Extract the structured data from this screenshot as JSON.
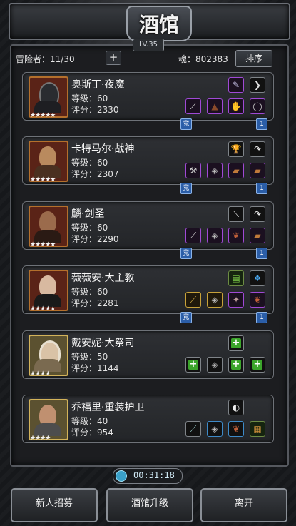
{
  "title": "酒馆",
  "level": "LV.35",
  "topbar": {
    "adventurers": "冒险者：11/30",
    "add_glyph": "+",
    "soul": "魂：802383",
    "sort_label": "排序"
  },
  "heroes": [
    {
      "name": "奥斯丁·夜魔",
      "level": "等级：60",
      "score": "评分：2330",
      "stars": "★★★★★",
      "portrait": "masked-knight"
    },
    {
      "name": "卡特马尔·战神",
      "level": "等级：60",
      "score": "评分：2307",
      "stars": "★★★★★",
      "portrait": "bearded-warrior"
    },
    {
      "name": "麟·剑圣",
      "level": "等级：60",
      "score": "评分：2290",
      "stars": "★★★★★",
      "portrait": "hat-swordsman"
    },
    {
      "name": "薇薇安·大主教",
      "level": "等级：60",
      "score": "评分：2281",
      "stars": "★★★★★",
      "portrait": "dark-haired-priestess"
    },
    {
      "name": "戴安妮·大祭司",
      "level": "等级：50",
      "score": "评分：1144",
      "stars": "★★★★",
      "portrait": "hooded-priestess"
    },
    {
      "name": "乔福里·重装护卫",
      "level": "等级：40",
      "score": "评分：954",
      "stars": "★★★★",
      "portrait": "armored-guard"
    }
  ],
  "tags": {
    "left": "竞",
    "right": "1"
  },
  "timer": "00:31:18",
  "buttons": {
    "recruit": "新人招募",
    "upgrade": "酒馆升级",
    "leave": "离开"
  },
  "colors": {
    "rare_border": "#b4702c",
    "epic_slot": "#a04ad6",
    "legend_slot": "#c8a23a",
    "add_green": "#3ba52b"
  }
}
